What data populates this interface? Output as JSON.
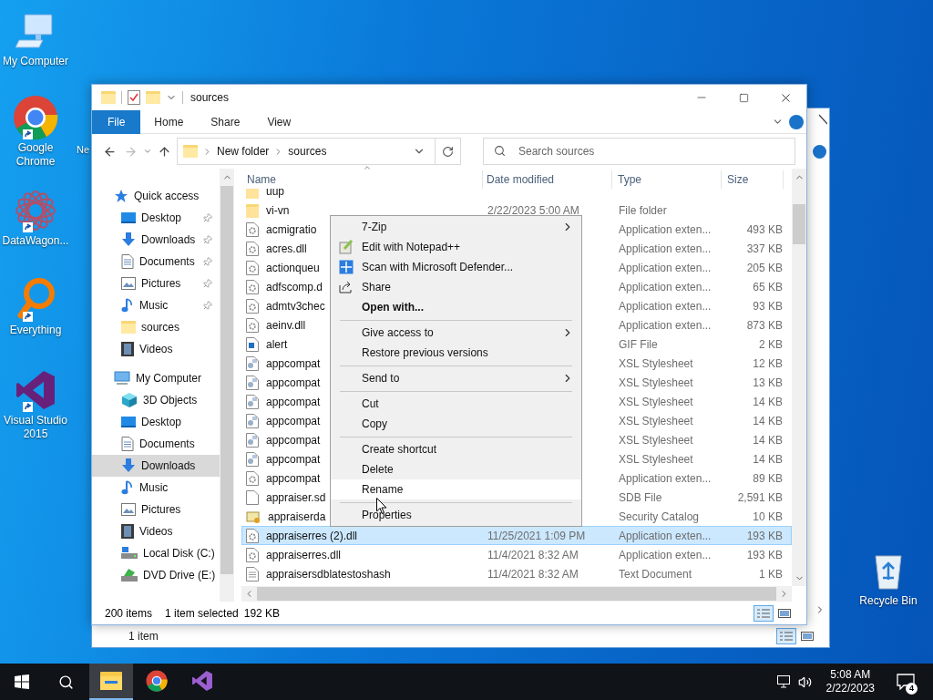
{
  "desktop_icons": [
    {
      "label": "My Computer",
      "kind": "computer"
    },
    {
      "label": "Google Chrome",
      "kind": "chrome"
    },
    {
      "label": "DataWagon...",
      "kind": "datawagon"
    },
    {
      "label": "Everything",
      "kind": "everything"
    },
    {
      "label": "Visual Studio 2015",
      "kind": "vs"
    },
    {
      "label": "Recycle Bin",
      "kind": "recycle"
    }
  ],
  "desktop_partial_label": "Ne",
  "back_window": {
    "status": "1 item"
  },
  "window": {
    "title": "sources",
    "ribbon_tabs": [
      {
        "label": "File",
        "selected": true
      },
      {
        "label": "Home",
        "selected": false
      },
      {
        "label": "Share",
        "selected": false
      },
      {
        "label": "View",
        "selected": false
      }
    ],
    "breadcrumb": [
      "New folder",
      "sources"
    ],
    "search": {
      "placeholder": "Search sources"
    },
    "nav": [
      {
        "label": "Quick access",
        "kind": "star",
        "selected": false,
        "children": [
          {
            "label": "Desktop",
            "kind": "desktop",
            "pinned": true,
            "selected": false
          },
          {
            "label": "Downloads",
            "kind": "download",
            "pinned": true,
            "selected": false
          },
          {
            "label": "Documents",
            "kind": "document",
            "pinned": true,
            "selected": false
          },
          {
            "label": "Pictures",
            "kind": "picture",
            "pinned": true,
            "selected": false
          },
          {
            "label": "Music",
            "kind": "music",
            "pinned": true,
            "selected": false
          },
          {
            "label": "sources",
            "kind": "folder",
            "pinned": false,
            "selected": false
          },
          {
            "label": "Videos",
            "kind": "video",
            "pinned": false,
            "selected": false
          }
        ]
      },
      {
        "label": "My Computer",
        "kind": "computer",
        "selected": false,
        "children": [
          {
            "label": "3D Objects",
            "kind": "cube",
            "pinned": false,
            "selected": false
          },
          {
            "label": "Desktop",
            "kind": "desktop",
            "pinned": false,
            "selected": false
          },
          {
            "label": "Documents",
            "kind": "document",
            "pinned": false,
            "selected": false
          },
          {
            "label": "Downloads",
            "kind": "download",
            "pinned": false,
            "selected": true
          },
          {
            "label": "Music",
            "kind": "music",
            "pinned": false,
            "selected": false
          },
          {
            "label": "Pictures",
            "kind": "picture",
            "pinned": false,
            "selected": false
          },
          {
            "label": "Videos",
            "kind": "video",
            "pinned": false,
            "selected": false
          },
          {
            "label": "Local Disk (C:)",
            "kind": "disk",
            "pinned": false,
            "selected": false
          },
          {
            "label": "DVD Drive (E:)",
            "kind": "dvd",
            "pinned": false,
            "selected": false
          }
        ]
      }
    ],
    "columns": [
      "Name",
      "Date modified",
      "Type",
      "Size"
    ],
    "rows": [
      {
        "name": "uup",
        "kind": "folder",
        "selected": false
      },
      {
        "name": "vi-vn",
        "date": "2/22/2023 5:00 AM",
        "type": "File folder",
        "kind": "folder",
        "selected": false
      },
      {
        "name": "acmigratio",
        "type": "Application exten...",
        "size": "493 KB",
        "kind": "dll",
        "selected": false
      },
      {
        "name": "acres.dll",
        "type": "Application exten...",
        "size": "337 KB",
        "kind": "dll",
        "selected": false
      },
      {
        "name": "actionqueu",
        "type": "Application exten...",
        "size": "205 KB",
        "kind": "dll",
        "selected": false
      },
      {
        "name": "adfscomp.d",
        "type": "Application exten...",
        "size": "65 KB",
        "kind": "dll",
        "selected": false
      },
      {
        "name": "admtv3chec",
        "type": "Application exten...",
        "size": "93 KB",
        "kind": "dll",
        "selected": false
      },
      {
        "name": "aeinv.dll",
        "type": "Application exten...",
        "size": "873 KB",
        "kind": "dll",
        "selected": false
      },
      {
        "name": "alert",
        "type": "GIF File",
        "size": "2 KB",
        "kind": "gif",
        "selected": false
      },
      {
        "name": "appcompat",
        "type": "XSL Stylesheet",
        "size": "12 KB",
        "kind": "xsl",
        "selected": false
      },
      {
        "name": "appcompat",
        "type": "XSL Stylesheet",
        "size": "13 KB",
        "kind": "xsl",
        "selected": false
      },
      {
        "name": "appcompat",
        "type": "XSL Stylesheet",
        "size": "14 KB",
        "kind": "xsl",
        "selected": false
      },
      {
        "name": "appcompat",
        "type": "XSL Stylesheet",
        "size": "14 KB",
        "kind": "xsl",
        "selected": false
      },
      {
        "name": "appcompat",
        "type": "XSL Stylesheet",
        "size": "14 KB",
        "kind": "xsl",
        "selected": false
      },
      {
        "name": "appcompat",
        "type": "XSL Stylesheet",
        "size": "14 KB",
        "kind": "xsl",
        "selected": false
      },
      {
        "name": "appcompat",
        "type": "Application exten...",
        "size": "89 KB",
        "kind": "dll",
        "selected": false
      },
      {
        "name": "appraiser.sd",
        "type": "SDB File",
        "size": "2,591 KB",
        "kind": "blank",
        "selected": false
      },
      {
        "name": "appraiserda",
        "type": "Security Catalog",
        "size": "10 KB",
        "kind": "cat",
        "selected": false
      },
      {
        "name": "appraiserres (2).dll",
        "date": "11/25/2021 1:09 PM",
        "type": "Application exten...",
        "size": "193 KB",
        "kind": "dll",
        "selected": true
      },
      {
        "name": "appraiserres.dll",
        "date": "11/4/2021 8:32 AM",
        "type": "Application exten...",
        "size": "193 KB",
        "kind": "dll",
        "selected": false
      },
      {
        "name": "appraisersdblatestoshash",
        "date": "11/4/2021 8:32 AM",
        "type": "Text Document",
        "size": "1 KB",
        "kind": "txt",
        "selected": false
      }
    ],
    "status": {
      "count": "200 items",
      "selection": "1 item selected",
      "size": "192 KB"
    }
  },
  "context_menu": [
    {
      "kind": "item",
      "label": "7-Zip",
      "submenu": true,
      "bold": false,
      "selected": false
    },
    {
      "kind": "notepad",
      "label": "Edit with Notepad++",
      "submenu": false,
      "bold": false,
      "selected": false
    },
    {
      "kind": "shield",
      "label": "Scan with Microsoft Defender...",
      "submenu": false,
      "bold": false,
      "selected": false
    },
    {
      "kind": "share",
      "label": "Share",
      "submenu": false,
      "bold": false,
      "selected": false
    },
    {
      "kind": "item",
      "label": "Open with...",
      "submenu": false,
      "bold": true,
      "selected": false
    },
    {
      "kind": "separator"
    },
    {
      "kind": "item",
      "label": "Give access to",
      "submenu": true,
      "bold": false,
      "selected": false
    },
    {
      "kind": "item",
      "label": "Restore previous versions",
      "submenu": false,
      "bold": false,
      "selected": false
    },
    {
      "kind": "separator"
    },
    {
      "kind": "item",
      "label": "Send to",
      "submenu": true,
      "bold": false,
      "selected": false
    },
    {
      "kind": "separator"
    },
    {
      "kind": "item",
      "label": "Cut",
      "submenu": false,
      "bold": false,
      "selected": false
    },
    {
      "kind": "item",
      "label": "Copy",
      "submenu": false,
      "bold": false,
      "selected": false
    },
    {
      "kind": "separator"
    },
    {
      "kind": "item",
      "label": "Create shortcut",
      "submenu": false,
      "bold": false,
      "selected": false
    },
    {
      "kind": "item",
      "label": "Delete",
      "submenu": false,
      "bold": false,
      "selected": false
    },
    {
      "kind": "item",
      "label": "Rename",
      "submenu": false,
      "bold": false,
      "selected": true
    },
    {
      "kind": "separator"
    },
    {
      "kind": "item",
      "label": "Properties",
      "submenu": false,
      "bold": false,
      "selected": false
    }
  ],
  "taskbar": {
    "apps": [
      {
        "kind": "explorer",
        "selected": true
      },
      {
        "kind": "chrome",
        "selected": false
      },
      {
        "kind": "vs",
        "selected": false
      }
    ],
    "time": "5:08 AM",
    "date": "2/22/2023",
    "notifications": "4"
  }
}
